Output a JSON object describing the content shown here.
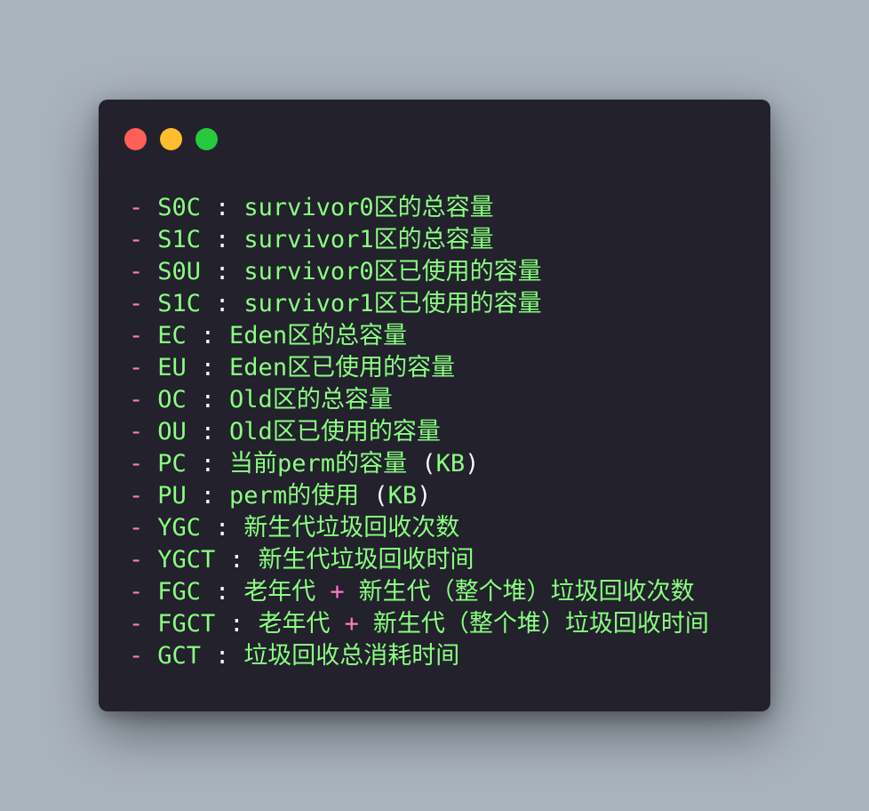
{
  "window": {
    "controls": {
      "close_color": "#ff5f56",
      "minimize_color": "#ffbd2e",
      "zoom_color": "#27c93f"
    }
  },
  "lines": [
    {
      "dash": "-",
      "key": "S0C",
      "sep": ":",
      "desc": "survivor0区的总容量"
    },
    {
      "dash": "-",
      "key": "S1C",
      "sep": ":",
      "desc": "survivor1区的总容量"
    },
    {
      "dash": "-",
      "key": "S0U",
      "sep": ":",
      "desc": "survivor0区已使用的容量"
    },
    {
      "dash": "-",
      "key": "S1C",
      "sep": ":",
      "desc": "survivor1区已使用的容量"
    },
    {
      "dash": "-",
      "key": "EC",
      "sep": ":",
      "desc": "Eden区的总容量"
    },
    {
      "dash": "-",
      "key": "EU",
      "sep": ":",
      "desc": "Eden区已使用的容量"
    },
    {
      "dash": "-",
      "key": "OC",
      "sep": ":",
      "desc": "Old区的总容量"
    },
    {
      "dash": "-",
      "key": "OU",
      "sep": ":",
      "desc": "Old区已使用的容量"
    },
    {
      "dash": "-",
      "key": "PC",
      "sep": ":",
      "desc": "当前perm的容量",
      "open": " (",
      "unit": "KB",
      "close": ")"
    },
    {
      "dash": "-",
      "key": "PU",
      "sep": ":",
      "desc": "perm的使用",
      "open": " (",
      "unit": "KB",
      "close": ")"
    },
    {
      "dash": "-",
      "key": "YGC",
      "sep": ":",
      "desc": "新生代垃圾回收次数"
    },
    {
      "dash": "-",
      "key": "YGCT",
      "sep": ":",
      "desc": "新生代垃圾回收时间"
    },
    {
      "dash": "-",
      "key": "FGC",
      "sep": ":",
      "desc_a": "老年代",
      "plus": "+",
      "desc_b": "新生代（整个堆）垃圾回收次数"
    },
    {
      "dash": "-",
      "key": "FGCT",
      "sep": ":",
      "desc_a": "老年代",
      "plus": "+",
      "desc_b": "新生代（整个堆）垃圾回收时间"
    },
    {
      "dash": "-",
      "key": "GCT",
      "sep": ":",
      "desc": "垃圾回收总消耗时间"
    }
  ]
}
